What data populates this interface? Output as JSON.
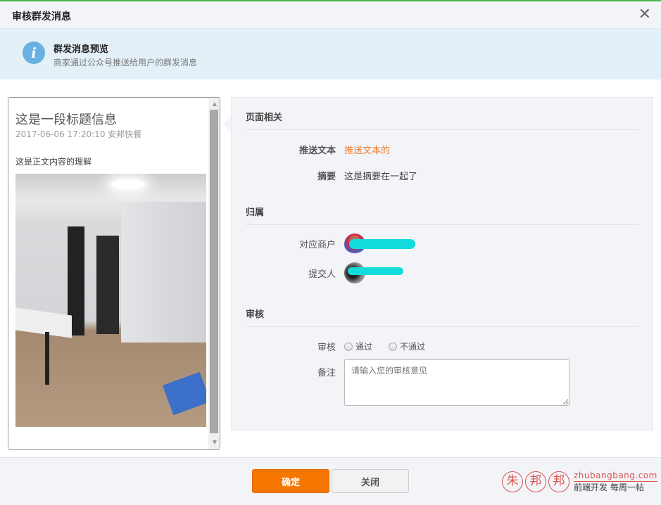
{
  "dialog": {
    "title": "审核群发消息"
  },
  "banner": {
    "title": "群发消息预览",
    "subtitle": "商家通过公众号推送给用户的群发消息"
  },
  "preview": {
    "title": "这是一段标题信息",
    "meta": "2017-06-06 17:20:10 安邦快餐",
    "body": "这是正文内容的理解"
  },
  "sections": {
    "page": {
      "heading": "页面相关",
      "push_text_label": "推送文本",
      "push_text_value": "推送文本的",
      "summary_label": "摘要",
      "summary_value": "这是摘要在一起了"
    },
    "owner": {
      "heading": "归属",
      "merchant_label": "对应商户",
      "submitter_label": "提交人"
    },
    "review": {
      "heading": "审核",
      "review_label": "审核",
      "options": [
        "通过",
        "不通过"
      ],
      "note_label": "备注",
      "note_placeholder": "请输入您的审核意见"
    }
  },
  "footer": {
    "ok": "确定",
    "close": "关闭"
  },
  "watermark": {
    "seals": [
      "朱",
      "邦",
      "邦"
    ],
    "site": "zhubangbang.com",
    "slogan": "前端开发 每周一帖"
  },
  "colors": {
    "accent": "#f57702",
    "orange_text": "#f07a2a",
    "topline": "#4cb848"
  }
}
